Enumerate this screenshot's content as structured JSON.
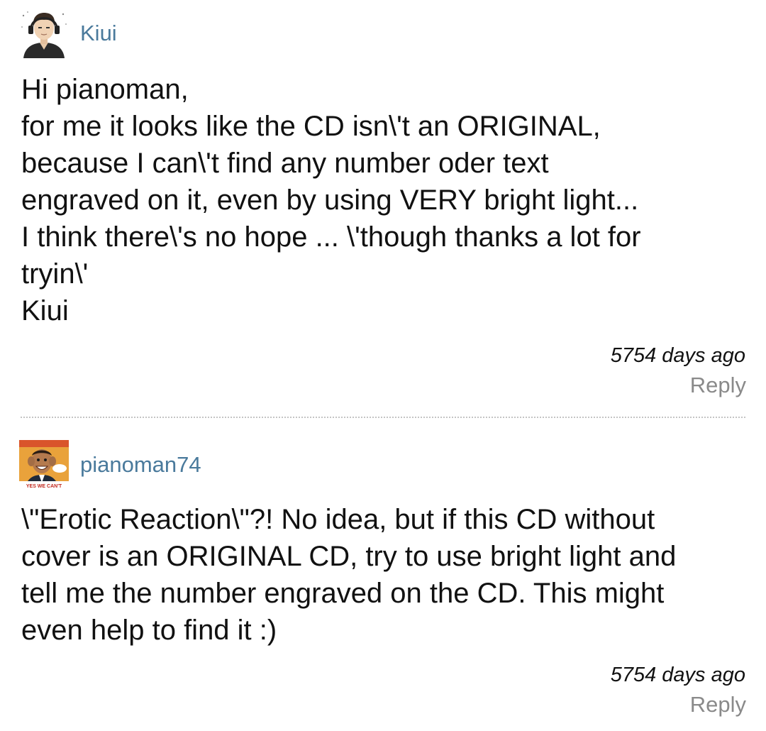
{
  "comments": [
    {
      "username": "Kiui",
      "avatar_icon": "male-avatar-with-headphones-icon",
      "lines": [
        "Hi pianoman,",
        "for me it looks like the CD isn\\'t an ORIGINAL,",
        "because I can\\'t find any number oder text",
        "engraved on it, even by using VERY bright light...",
        "I think there\\'s no hope ... \\'though thanks a lot for",
        "tryin\\'",
        "Kiui"
      ],
      "timestamp": "5754 days ago",
      "reply_label": "Reply"
    },
    {
      "username": "pianoman74",
      "avatar_icon": "magazine-cover-avatar-icon",
      "avatar_text": "YES WE CAN'T",
      "lines": [
        "\\\"Erotic Reaction\\\"?! No idea, but if this CD without",
        "cover is an ORIGINAL CD, try to use bright light and",
        "tell me the number engraved on the CD. This might",
        "even help to find it :)"
      ],
      "timestamp": "5754 days ago",
      "reply_label": "Reply"
    }
  ],
  "colors": {
    "username": "#4a7a9c",
    "reply": "#8a8a8a",
    "divider": "#c4c4c4",
    "text": "#111111"
  }
}
